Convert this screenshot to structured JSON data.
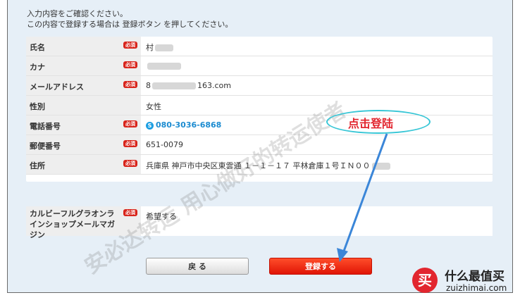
{
  "intro": {
    "line1": "入力内容をご確認ください。",
    "line2": "この内容で登録する場合は 登録ボタン を押してください。"
  },
  "required_label": "必須",
  "rows": [
    {
      "label": "氏名",
      "required": true,
      "value": "村"
    },
    {
      "label": "カナ",
      "required": true,
      "value": ""
    },
    {
      "label": "メールアドレス",
      "required": true,
      "value_prefix": "8",
      "value_suffix": "163.com"
    },
    {
      "label": "性別",
      "required": false,
      "value": "女性"
    },
    {
      "label": "電話番号",
      "required": true,
      "value": "080-3036-6868"
    },
    {
      "label": "郵便番号",
      "required": true,
      "value": "651-0079"
    },
    {
      "label": "住所",
      "required": true,
      "value": "兵庫県 神戸市中央区東雲通 １－１－１７ 平林倉庫１号ＩＮ００"
    }
  ],
  "newsletter": {
    "label": "カルビーフルグラオンラインショップメールマガジン",
    "required": true,
    "value": "希望する"
  },
  "buttons": {
    "back": "戻 る",
    "register": "登録する"
  },
  "annotation": {
    "text": "点击登陆",
    "ellipse_color": "#37c6d6",
    "text_color": "#e2262f",
    "arrow_color": "#3b86d8"
  },
  "watermark": "安必达转运 用心做好的转运使者",
  "logo": {
    "mark": "买",
    "cn": "什么最值买",
    "en": "zuizhimai.com"
  },
  "colors": {
    "required_badge": "#d8241b",
    "register_button": "#e8270f",
    "phone_link": "#1b8bd0",
    "background": "#e6eff7"
  }
}
